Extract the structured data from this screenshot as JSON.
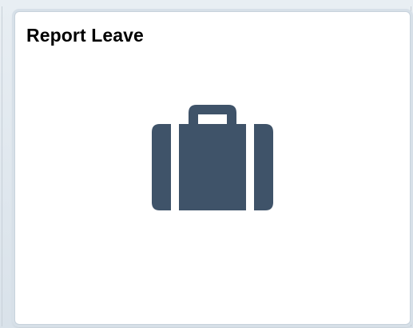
{
  "tile": {
    "title": "Report Leave",
    "icon": "briefcase-icon",
    "icon_color": "#3f5369",
    "background": "#ffffff",
    "border_color": "#c7d2dc"
  }
}
